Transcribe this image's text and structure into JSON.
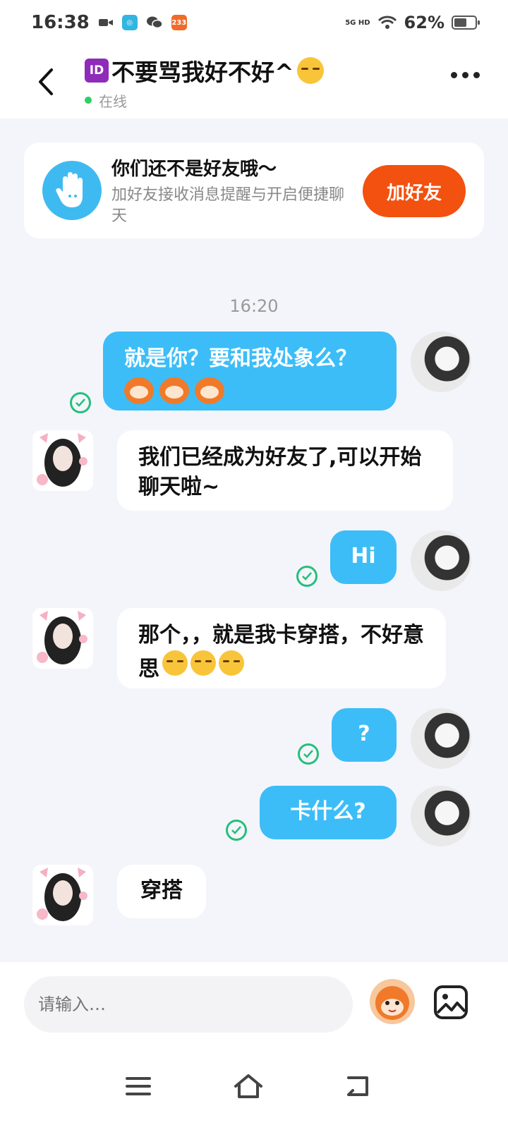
{
  "status_bar": {
    "time": "16:38",
    "network": "5G HD",
    "battery": "62%",
    "battery_level": 0.62
  },
  "header": {
    "title": "不要骂我好不好^",
    "id_badge": "ID",
    "status": "在线"
  },
  "friend_card": {
    "title": "你们还不是好友哦～",
    "description": "加好友接收消息提醒与开启便捷聊天",
    "button": "加好友"
  },
  "time_divider": "16:20",
  "messages": [
    {
      "from": "me",
      "text": "就是你？要和我处象么？"
    },
    {
      "from": "other",
      "text": "我们已经成为好友了,可以开始聊天啦~"
    },
    {
      "from": "me",
      "text": "Hi"
    },
    {
      "from": "other",
      "text": "那个，，就是我卡穿搭，不好意思"
    },
    {
      "from": "me",
      "text": "?"
    },
    {
      "from": "me",
      "text": "卡什么?"
    },
    {
      "from": "other",
      "text": "穿搭"
    }
  ],
  "input": {
    "placeholder": "请输入…"
  },
  "colors": {
    "accent": "#3cbdf7",
    "add_friend": "#f2510f",
    "online": "#33cc66",
    "read_check": "#26bf7a"
  },
  "icons": [
    "back-icon",
    "more-icon",
    "hand-icon",
    "check-icon",
    "sticker-icon",
    "image-icon",
    "menu-icon",
    "home-icon",
    "back-nav-icon"
  ]
}
